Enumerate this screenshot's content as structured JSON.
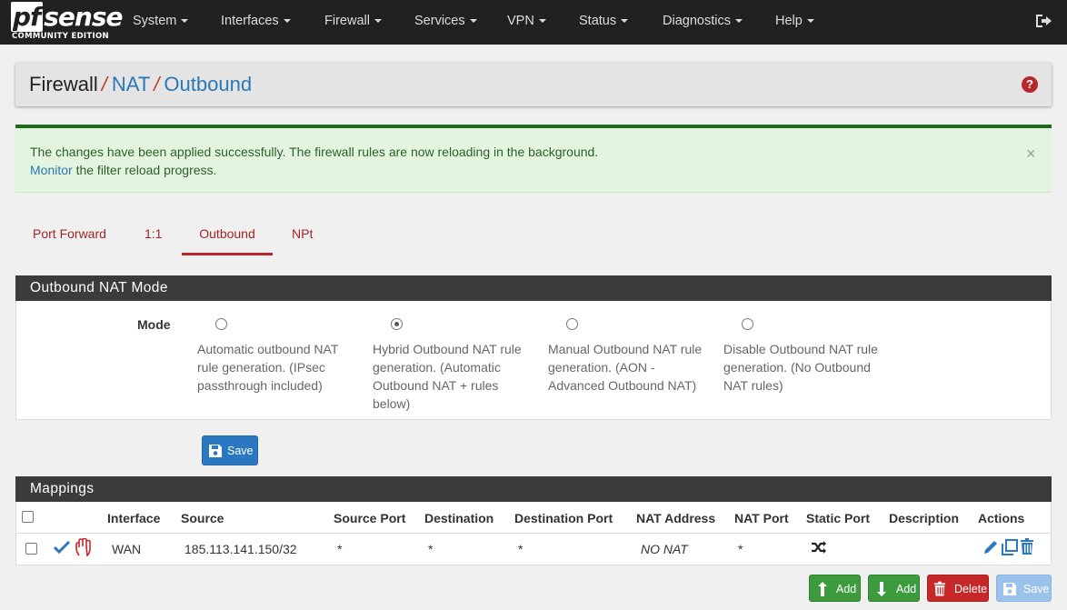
{
  "navbar": {
    "logo_main": "sense",
    "logo_pf": "pf",
    "logo_sub": "COMMUNITY EDITION",
    "items": [
      "System",
      "Interfaces",
      "Firewall",
      "Services",
      "VPN",
      "Status",
      "Diagnostics",
      "Help"
    ]
  },
  "breadcrumb": {
    "first": "Firewall",
    "second": "NAT",
    "third": "Outbound",
    "help_icon": "question-circle-icon"
  },
  "alert": {
    "line1": "The changes have been applied successfully. The firewall rules are now reloading in the background.",
    "link": "Monitor",
    "line2_rest": " the filter reload progress.",
    "close": "×"
  },
  "tabs": [
    "Port Forward",
    "1:1",
    "Outbound",
    "NPt"
  ],
  "active_tab": "Outbound",
  "mode_panel": {
    "title": "Outbound NAT Mode",
    "label": "Mode",
    "options": [
      {
        "text": "Automatic outbound NAT rule generation. (IPsec passthrough included)",
        "checked": false
      },
      {
        "text": "Hybrid Outbound NAT rule generation. (Automatic Outbound NAT + rules below)",
        "checked": true
      },
      {
        "text": "Manual Outbound NAT rule generation. (AON - Advanced Outbound NAT)",
        "checked": false
      },
      {
        "text": "Disable Outbound NAT rule generation. (No Outbound NAT rules)",
        "checked": false
      }
    ],
    "save_label": "Save"
  },
  "mappings": {
    "title": "Mappings",
    "headers": [
      "Interface",
      "Source",
      "Source Port",
      "Destination",
      "Destination Port",
      "NAT Address",
      "NAT Port",
      "Static Port",
      "Description",
      "Actions"
    ],
    "rows": [
      {
        "interface": "WAN",
        "source": "185.113.141.150/32",
        "source_port": "*",
        "destination": "*",
        "destination_port": "*",
        "nat_address": "NO NAT",
        "nat_port": "*",
        "static_port": "shuffle-icon",
        "description": ""
      }
    ]
  },
  "bottom_buttons": {
    "add_top": "Add",
    "add_bottom": "Add",
    "delete": "Delete",
    "save": "Save"
  },
  "colors": {
    "navbar": "#212121",
    "primary": "#2b78c2",
    "success": "#3d9b3d",
    "danger": "#c62828",
    "accent_red": "#b5282e",
    "alert_bg": "#e4f5df"
  }
}
